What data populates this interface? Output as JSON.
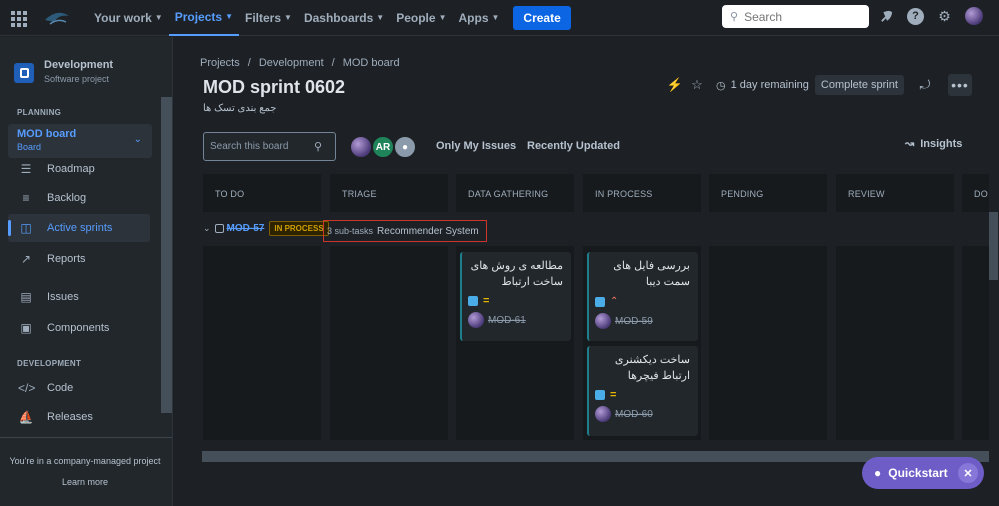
{
  "nav": {
    "items": [
      {
        "label": "Your work",
        "active": false
      },
      {
        "label": "Projects",
        "active": true
      },
      {
        "label": "Filters",
        "active": false
      },
      {
        "label": "Dashboards",
        "active": false
      },
      {
        "label": "People",
        "active": false
      },
      {
        "label": "Apps",
        "active": false
      }
    ],
    "create": "Create",
    "search_placeholder": "Search"
  },
  "sidebar": {
    "project_name": "Development",
    "project_type": "Software project",
    "planning_label": "PLANNING",
    "board_title": "MOD board",
    "board_sub": "Board",
    "items": [
      {
        "label": "Roadmap",
        "icon": "roadmap-icon"
      },
      {
        "label": "Backlog",
        "icon": "backlog-icon"
      },
      {
        "label": "Active sprints",
        "icon": "board-icon",
        "active": true
      },
      {
        "label": "Reports",
        "icon": "reports-icon"
      },
      {
        "label": "Issues",
        "icon": "issues-icon"
      },
      {
        "label": "Components",
        "icon": "components-icon"
      }
    ],
    "development_label": "DEVELOPMENT",
    "dev_items": [
      {
        "label": "Code",
        "icon": "code-icon"
      },
      {
        "label": "Releases",
        "icon": "releases-icon"
      }
    ],
    "footer": "You're in a company-managed project",
    "learn_more": "Learn more"
  },
  "breadcrumb": [
    "Projects",
    "Development",
    "MOD board"
  ],
  "page": {
    "title": "MOD sprint 0602",
    "goal": "جمع بندی تسک ها",
    "remaining": "1 day remaining",
    "complete": "Complete sprint"
  },
  "toolbar": {
    "search_placeholder": "Search this board",
    "avatar_initials": "AR",
    "only_my": "Only My Issues",
    "recent": "Recently Updated",
    "insights": "Insights"
  },
  "columns": [
    "TO DO",
    "TRIAGE",
    "DATA GATHERING",
    "IN PROCESS",
    "PENDING",
    "REVIEW",
    "DO"
  ],
  "swimlane": {
    "key": "MOD-57",
    "status": "IN PROCESS",
    "subtasks": "3 sub-tasks",
    "summary": "Recommender System"
  },
  "cards": [
    {
      "title": "مطالعه ی روش های ساخت ارتباط",
      "key": "MOD-61",
      "priority": "medium"
    },
    {
      "title": "بررسی فایل های سمت دیبا",
      "key": "MOD-59",
      "priority": "high"
    },
    {
      "title": "ساخت دیکشنری ارتباط فیچرها",
      "key": "MOD-60",
      "priority": "medium"
    }
  ],
  "quickstart": "Quickstart",
  "colors": {
    "accent": "#579dff",
    "create": "#0c66e4",
    "quickstart": "#6e5dc6",
    "highlight_box": "#c9372c"
  }
}
